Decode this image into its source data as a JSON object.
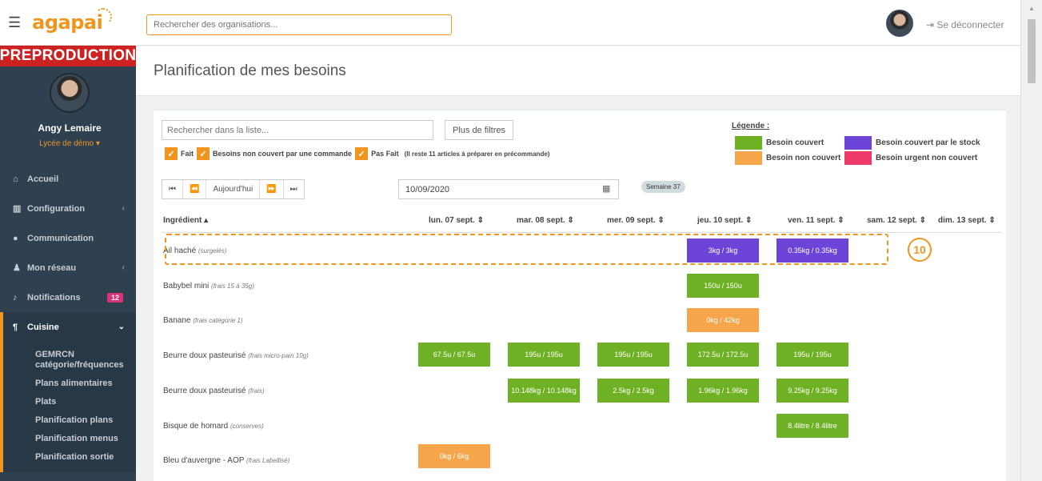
{
  "brand": {
    "logo": "agapai",
    "env_banner": "PREPRODUCTION"
  },
  "profile": {
    "name": "Angy Lemaire",
    "school": "Lycée de démo ▾"
  },
  "sidebar": {
    "items": [
      {
        "label": "Accueil",
        "icon": "home-icon"
      },
      {
        "label": "Configuration",
        "icon": "bank-icon",
        "chevron": "‹"
      },
      {
        "label": "Communication",
        "icon": "chat-icon"
      },
      {
        "label": "Mon réseau",
        "icon": "users-icon",
        "chevron": "‹"
      },
      {
        "label": "Notifications",
        "icon": "bell-icon",
        "badge": "12"
      },
      {
        "label": "Cuisine",
        "icon": "cutlery-icon",
        "chevron": "⌄"
      }
    ],
    "cuisine_sub": [
      "GEMRCN catégorie/fréquences",
      "Plans alimentaires",
      "Plats",
      "Planification plans",
      "Planification menus",
      "Planification sortie"
    ]
  },
  "topbar": {
    "search_placeholder": "Rechercher des organisations...",
    "logout": "Se déconnecter"
  },
  "page": {
    "title": "Planification de mes besoins"
  },
  "toolbar": {
    "list_search_placeholder": "Rechercher dans la liste...",
    "filters_button": "Plus de filtres",
    "check_done": "Fait",
    "check_uncovered": "Besoins non couvert par une commande",
    "check_not_done": "Pas Fait",
    "check_note": "(Il reste 11 articles à préparer en précommande)",
    "nav_first": "⏮",
    "nav_prev": "⏪",
    "nav_today": "Aujourd'hui",
    "nav_next": "⏩",
    "nav_last": "⏭",
    "date_value": "10/09/2020",
    "week_badge": "Semaine 37"
  },
  "legend": {
    "title": "Légende :",
    "covered": "Besoin couvert",
    "not_covered": "Besoin non couvert",
    "stock": "Besoin couvert par le stock",
    "urgent": "Besoin urgent non couvert"
  },
  "colors": {
    "covered": "#6fb124",
    "not_covered": "#f7a54a",
    "stock": "#6c45d8",
    "urgent": "#ee3a6a",
    "accent": "#f0961e"
  },
  "table": {
    "headers": [
      "Ingrédient ▴",
      "lun. 07 sept. ⇕",
      "mar. 08 sept. ⇕",
      "mer. 09 sept. ⇕",
      "jeu. 10 sept. ⇕",
      "ven. 11 sept. ⇕",
      "sam. 12 sept. ⇕",
      "dim. 13 sept. ⇕"
    ],
    "rows": [
      {
        "name": "Ail haché",
        "category": "(surgelés)",
        "cells": {
          "jeu": {
            "text": "3kg / 3kg",
            "status": "stock"
          },
          "ven": {
            "text": "0.35kg / 0.35kg",
            "status": "stock"
          }
        }
      },
      {
        "name": "Babybel mini",
        "category": "(frais 15 à 35g)",
        "cells": {
          "jeu": {
            "text": "150u / 150u",
            "status": "covered"
          }
        }
      },
      {
        "name": "Banane",
        "category": "(frais catégorie 1)",
        "cells": {
          "jeu": {
            "text": "0kg / 42kg",
            "status": "not_covered"
          }
        }
      },
      {
        "name": "Beurre doux pasteurisé",
        "category": "(frais micro-pain 10g)",
        "cells": {
          "lun": {
            "text": "67.5u / 67.5u",
            "status": "covered"
          },
          "mar": {
            "text": "195u / 195u",
            "status": "covered"
          },
          "mer": {
            "text": "195u / 195u",
            "status": "covered"
          },
          "jeu": {
            "text": "172.5u / 172.5u",
            "status": "covered"
          },
          "ven": {
            "text": "195u / 195u",
            "status": "covered"
          }
        }
      },
      {
        "name": "Beurre doux pasteurisé",
        "category": "(frais)",
        "cells": {
          "mar": {
            "text": "10.148kg / 10.148kg",
            "status": "covered"
          },
          "mer": {
            "text": "2.5kg / 2.5kg",
            "status": "covered"
          },
          "jeu": {
            "text": "1.96kg / 1.96kg",
            "status": "covered"
          },
          "ven": {
            "text": "9.25kg / 9.25kg",
            "status": "covered"
          }
        }
      },
      {
        "name": "Bisque de homard",
        "category": "(conserves)",
        "cells": {
          "ven": {
            "text": "8.4litre / 8.4litre",
            "status": "covered"
          }
        }
      },
      {
        "name": "Bleu d'auvergne - AOP",
        "category": "(frais Labellisé)",
        "cells": {
          "lun": {
            "text": "0kg / 6kg",
            "status": "not_covered"
          }
        }
      }
    ]
  },
  "annotation": {
    "callout_number": "10"
  }
}
